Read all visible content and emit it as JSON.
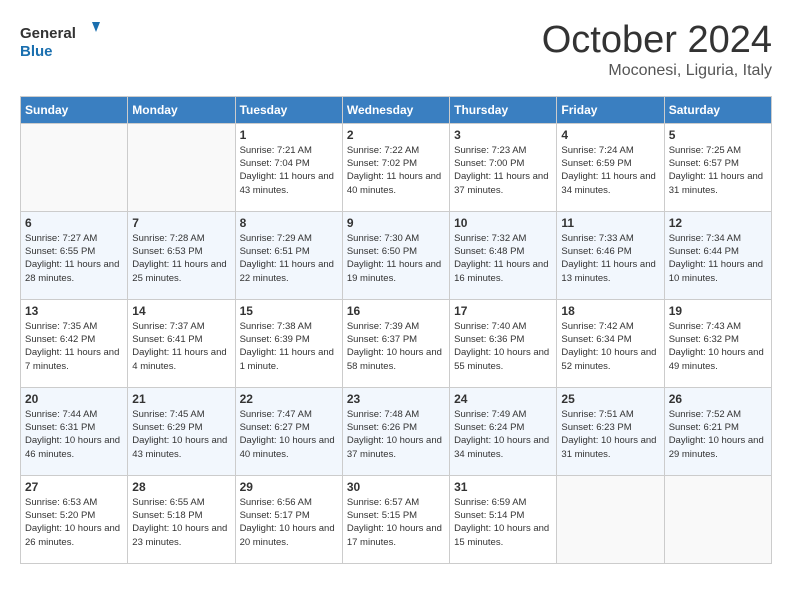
{
  "header": {
    "logo_general": "General",
    "logo_blue": "Blue",
    "month": "October 2024",
    "location": "Moconesi, Liguria, Italy"
  },
  "days_of_week": [
    "Sunday",
    "Monday",
    "Tuesday",
    "Wednesday",
    "Thursday",
    "Friday",
    "Saturday"
  ],
  "weeks": [
    [
      {
        "day": "",
        "content": ""
      },
      {
        "day": "",
        "content": ""
      },
      {
        "day": "1",
        "content": "Sunrise: 7:21 AM\nSunset: 7:04 PM\nDaylight: 11 hours and 43 minutes."
      },
      {
        "day": "2",
        "content": "Sunrise: 7:22 AM\nSunset: 7:02 PM\nDaylight: 11 hours and 40 minutes."
      },
      {
        "day": "3",
        "content": "Sunrise: 7:23 AM\nSunset: 7:00 PM\nDaylight: 11 hours and 37 minutes."
      },
      {
        "day": "4",
        "content": "Sunrise: 7:24 AM\nSunset: 6:59 PM\nDaylight: 11 hours and 34 minutes."
      },
      {
        "day": "5",
        "content": "Sunrise: 7:25 AM\nSunset: 6:57 PM\nDaylight: 11 hours and 31 minutes."
      }
    ],
    [
      {
        "day": "6",
        "content": "Sunrise: 7:27 AM\nSunset: 6:55 PM\nDaylight: 11 hours and 28 minutes."
      },
      {
        "day": "7",
        "content": "Sunrise: 7:28 AM\nSunset: 6:53 PM\nDaylight: 11 hours and 25 minutes."
      },
      {
        "day": "8",
        "content": "Sunrise: 7:29 AM\nSunset: 6:51 PM\nDaylight: 11 hours and 22 minutes."
      },
      {
        "day": "9",
        "content": "Sunrise: 7:30 AM\nSunset: 6:50 PM\nDaylight: 11 hours and 19 minutes."
      },
      {
        "day": "10",
        "content": "Sunrise: 7:32 AM\nSunset: 6:48 PM\nDaylight: 11 hours and 16 minutes."
      },
      {
        "day": "11",
        "content": "Sunrise: 7:33 AM\nSunset: 6:46 PM\nDaylight: 11 hours and 13 minutes."
      },
      {
        "day": "12",
        "content": "Sunrise: 7:34 AM\nSunset: 6:44 PM\nDaylight: 11 hours and 10 minutes."
      }
    ],
    [
      {
        "day": "13",
        "content": "Sunrise: 7:35 AM\nSunset: 6:42 PM\nDaylight: 11 hours and 7 minutes."
      },
      {
        "day": "14",
        "content": "Sunrise: 7:37 AM\nSunset: 6:41 PM\nDaylight: 11 hours and 4 minutes."
      },
      {
        "day": "15",
        "content": "Sunrise: 7:38 AM\nSunset: 6:39 PM\nDaylight: 11 hours and 1 minute."
      },
      {
        "day": "16",
        "content": "Sunrise: 7:39 AM\nSunset: 6:37 PM\nDaylight: 10 hours and 58 minutes."
      },
      {
        "day": "17",
        "content": "Sunrise: 7:40 AM\nSunset: 6:36 PM\nDaylight: 10 hours and 55 minutes."
      },
      {
        "day": "18",
        "content": "Sunrise: 7:42 AM\nSunset: 6:34 PM\nDaylight: 10 hours and 52 minutes."
      },
      {
        "day": "19",
        "content": "Sunrise: 7:43 AM\nSunset: 6:32 PM\nDaylight: 10 hours and 49 minutes."
      }
    ],
    [
      {
        "day": "20",
        "content": "Sunrise: 7:44 AM\nSunset: 6:31 PM\nDaylight: 10 hours and 46 minutes."
      },
      {
        "day": "21",
        "content": "Sunrise: 7:45 AM\nSunset: 6:29 PM\nDaylight: 10 hours and 43 minutes."
      },
      {
        "day": "22",
        "content": "Sunrise: 7:47 AM\nSunset: 6:27 PM\nDaylight: 10 hours and 40 minutes."
      },
      {
        "day": "23",
        "content": "Sunrise: 7:48 AM\nSunset: 6:26 PM\nDaylight: 10 hours and 37 minutes."
      },
      {
        "day": "24",
        "content": "Sunrise: 7:49 AM\nSunset: 6:24 PM\nDaylight: 10 hours and 34 minutes."
      },
      {
        "day": "25",
        "content": "Sunrise: 7:51 AM\nSunset: 6:23 PM\nDaylight: 10 hours and 31 minutes."
      },
      {
        "day": "26",
        "content": "Sunrise: 7:52 AM\nSunset: 6:21 PM\nDaylight: 10 hours and 29 minutes."
      }
    ],
    [
      {
        "day": "27",
        "content": "Sunrise: 6:53 AM\nSunset: 5:20 PM\nDaylight: 10 hours and 26 minutes."
      },
      {
        "day": "28",
        "content": "Sunrise: 6:55 AM\nSunset: 5:18 PM\nDaylight: 10 hours and 23 minutes."
      },
      {
        "day": "29",
        "content": "Sunrise: 6:56 AM\nSunset: 5:17 PM\nDaylight: 10 hours and 20 minutes."
      },
      {
        "day": "30",
        "content": "Sunrise: 6:57 AM\nSunset: 5:15 PM\nDaylight: 10 hours and 17 minutes."
      },
      {
        "day": "31",
        "content": "Sunrise: 6:59 AM\nSunset: 5:14 PM\nDaylight: 10 hours and 15 minutes."
      },
      {
        "day": "",
        "content": ""
      },
      {
        "day": "",
        "content": ""
      }
    ]
  ]
}
